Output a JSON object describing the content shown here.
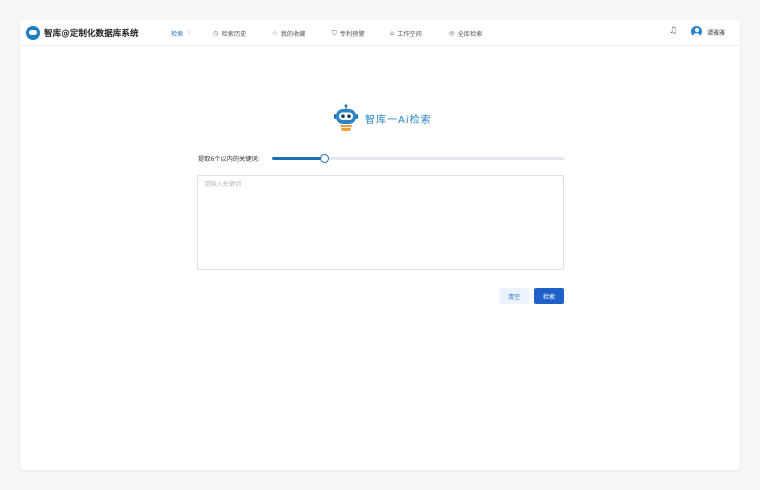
{
  "app": {
    "title": "智库@定制化数据库系统"
  },
  "nav": [
    {
      "label": "检索",
      "icon": "chevron-down-icon",
      "active": true
    },
    {
      "label": "检索历史",
      "icon": "history-icon",
      "glyph": "◷",
      "active": false
    },
    {
      "label": "我的收藏",
      "icon": "star-icon",
      "glyph": "☆",
      "active": false
    },
    {
      "label": "专利预警",
      "icon": "shield-icon",
      "glyph": "⛉",
      "active": false
    },
    {
      "label": "工作空间",
      "icon": "workspace-icon",
      "glyph": "⌂",
      "active": false
    },
    {
      "label": "全库检索",
      "icon": "globe-icon",
      "glyph": "◎",
      "active": false
    }
  ],
  "user": {
    "name": "谭雅雅"
  },
  "ai_search": {
    "title": "智库一Ai检索",
    "slider_label": "提取6个以内的关键词:",
    "slider_value_fraction": 0.18,
    "input_placeholder": "请输入关键词",
    "input_value": "",
    "clear_label": "清空",
    "search_label": "检索"
  },
  "colors": {
    "accent": "#2b78c9",
    "primary_button": "#2060c9",
    "brand": "#1f7dc0"
  }
}
